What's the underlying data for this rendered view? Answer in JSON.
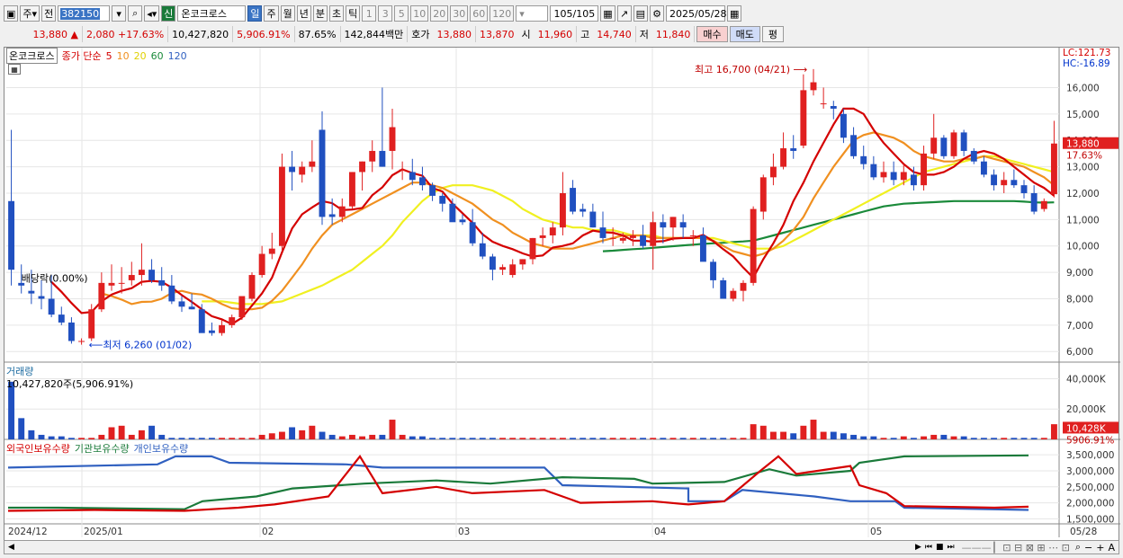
{
  "toolbar": {
    "type1": "주",
    "type2": "전",
    "code": "382150",
    "name": "온코크로스",
    "badge": "신",
    "periods": [
      "일",
      "주",
      "월",
      "년",
      "분",
      "초",
      "틱"
    ],
    "active_period": "일",
    "nums": [
      "1",
      "3",
      "5",
      "10",
      "20",
      "30",
      "60",
      "120"
    ],
    "count": "105/105",
    "date": "2025/05/28"
  },
  "quote": {
    "price": "13,880",
    "arrow": "▲",
    "change": "2,080",
    "rate": "+17.63%",
    "volume": "10,427,820",
    "vol_rate": "5,906.91%",
    "ratio": "87.65%",
    "amount": "142,844백만",
    "ask_label": "호가",
    "ask": "13,880",
    "bid": "13,870",
    "open_label": "시",
    "open": "11,960",
    "high_label": "고",
    "high": "14,740",
    "low_label": "저",
    "low": "11,840",
    "buy": "매수",
    "sell": "매도",
    "eval": "평"
  },
  "price_panel": {
    "name": "온코크로스",
    "series_label": "종가 단순",
    "ma": [
      {
        "p": "5",
        "c": "#d40000"
      },
      {
        "p": "10",
        "c": "#f09020"
      },
      {
        "p": "20",
        "c": "#e0e000"
      },
      {
        "p": "60",
        "c": "#1a8a3a"
      },
      {
        "p": "120",
        "c": "#3060c0"
      }
    ],
    "lc": "LC:121.73",
    "hc": "HC:-16.89",
    "high_note": "최고 16,700 (04/21)",
    "low_note": "최저 6,260 (01/02)",
    "div_note": "배당락(0.00%)",
    "yticks": [
      "16,000",
      "15,000",
      "14,000",
      "13,000",
      "12,000",
      "11,000",
      "10,000",
      "9,000",
      "8,000",
      "7,000",
      "6,000"
    ],
    "last_price": "13,880",
    "last_rate": "17.63%"
  },
  "volume_panel": {
    "title": "거래량",
    "readout": "10,427,820주(5,906.91%)",
    "yticks": [
      "40,000K",
      "20,000K"
    ],
    "last": "10,428K",
    "last_rate": "5906.91%"
  },
  "holder_panel": {
    "legend": [
      {
        "t": "외국인보유수량",
        "c": "#d40000"
      },
      {
        "t": "기관보유수량",
        "c": "#1a7a3a"
      },
      {
        "t": "개인보유수량",
        "c": "#3060c0"
      }
    ],
    "yticks": [
      "3,500,000",
      "3,000,000",
      "2,500,000",
      "2,000,000",
      "1,500,000"
    ]
  },
  "xaxis": [
    "2024/12",
    "2025/01",
    "02",
    "03",
    "04",
    "05",
    "05/28"
  ],
  "colors": {
    "up": "#e02020",
    "down": "#2050c0",
    "ma5": "#d40000",
    "ma10": "#f09020",
    "ma20": "#f0f020",
    "ma60": "#1a8a3a"
  },
  "chart_data": {
    "type": "candlestick",
    "note": "daily candles approx., KRW",
    "candles": [
      [
        11700,
        14400,
        8500,
        9100
      ],
      [
        8600,
        9300,
        8200,
        8500
      ],
      [
        8300,
        9100,
        7800,
        8200
      ],
      [
        8100,
        8700,
        7600,
        8000
      ],
      [
        8000,
        8900,
        7300,
        7400
      ],
      [
        7400,
        7700,
        7000,
        7100
      ],
      [
        7100,
        7300,
        6300,
        6400
      ],
      [
        6400,
        6500,
        6260,
        6400
      ],
      [
        6500,
        7800,
        6400,
        7600
      ],
      [
        7600,
        9000,
        7500,
        8600
      ],
      [
        8500,
        9300,
        8300,
        8600
      ],
      [
        8600,
        9200,
        8200,
        8600
      ],
      [
        8700,
        9400,
        8500,
        8900
      ],
      [
        8900,
        10100,
        8500,
        9100
      ],
      [
        9100,
        9500,
        8600,
        8700
      ],
      [
        8700,
        9200,
        8300,
        8500
      ],
      [
        8500,
        8900,
        7800,
        7900
      ],
      [
        7900,
        8100,
        7500,
        7700
      ],
      [
        7700,
        8200,
        7600,
        7600
      ],
      [
        7600,
        7800,
        6800,
        6700
      ],
      [
        6800,
        7100,
        6600,
        6700
      ],
      [
        6700,
        7200,
        6600,
        7000
      ],
      [
        7000,
        7400,
        6900,
        7300
      ],
      [
        7300,
        8000,
        7200,
        8100
      ],
      [
        8000,
        9000,
        7900,
        8900
      ],
      [
        8900,
        10000,
        8800,
        9700
      ],
      [
        9700,
        10500,
        9500,
        9900
      ],
      [
        10000,
        13500,
        9800,
        13000
      ],
      [
        13000,
        13600,
        12100,
        12800
      ],
      [
        12700,
        13200,
        12400,
        13000
      ],
      [
        13000,
        14000,
        12800,
        13200
      ],
      [
        14400,
        15100,
        10800,
        11100
      ],
      [
        11200,
        11800,
        10800,
        11100
      ],
      [
        11100,
        11800,
        10900,
        11500
      ],
      [
        11500,
        12800,
        11400,
        12800
      ],
      [
        12800,
        13200,
        12100,
        13200
      ],
      [
        13200,
        14000,
        12800,
        13600
      ],
      [
        13600,
        16000,
        13000,
        13000
      ],
      [
        13600,
        15200,
        12900,
        14500
      ],
      [
        12900,
        13200,
        12500,
        12900
      ],
      [
        12800,
        13300,
        12300,
        12500
      ],
      [
        12600,
        13000,
        12100,
        12300
      ],
      [
        12300,
        12400,
        11700,
        11900
      ],
      [
        11900,
        12000,
        11300,
        11600
      ],
      [
        11600,
        11800,
        11000,
        10900
      ],
      [
        11000,
        11200,
        10800,
        10900
      ],
      [
        10900,
        11400,
        10000,
        10100
      ],
      [
        10100,
        10500,
        9500,
        9600
      ],
      [
        9600,
        9700,
        8700,
        9100
      ],
      [
        9100,
        9300,
        8900,
        9200
      ],
      [
        8900,
        9500,
        8800,
        9300
      ],
      [
        9300,
        9500,
        9100,
        9500
      ],
      [
        9500,
        10300,
        9300,
        10300
      ],
      [
        10300,
        10700,
        10000,
        10400
      ],
      [
        10400,
        10900,
        10100,
        10700
      ],
      [
        10700,
        12800,
        10400,
        12000
      ],
      [
        12200,
        12500,
        11200,
        11300
      ],
      [
        11400,
        11600,
        11100,
        11300
      ],
      [
        11300,
        11600,
        10700,
        10700
      ],
      [
        10700,
        11300,
        10100,
        10300
      ],
      [
        10300,
        10700,
        10000,
        10300
      ],
      [
        10200,
        10500,
        10100,
        10300
      ],
      [
        10300,
        10600,
        10000,
        10400
      ],
      [
        10400,
        10800,
        9900,
        10000
      ],
      [
        10000,
        11300,
        9100,
        10900
      ],
      [
        10900,
        11200,
        10100,
        10700
      ],
      [
        10700,
        11100,
        10200,
        11100
      ],
      [
        10900,
        11200,
        10300,
        10700
      ],
      [
        10400,
        10600,
        10000,
        10400
      ],
      [
        10400,
        10700,
        9900,
        9400
      ],
      [
        9400,
        9500,
        8400,
        8700
      ],
      [
        8700,
        8800,
        8100,
        8000
      ],
      [
        8000,
        8400,
        7900,
        8300
      ],
      [
        8300,
        8700,
        7900,
        8600
      ],
      [
        8600,
        11500,
        8500,
        11400
      ],
      [
        11300,
        12700,
        11000,
        12600
      ],
      [
        12600,
        13500,
        12300,
        13000
      ],
      [
        13000,
        14300,
        12900,
        13700
      ],
      [
        13700,
        14200,
        13300,
        13600
      ],
      [
        13800,
        16500,
        13700,
        15900
      ],
      [
        15900,
        16700,
        15700,
        16200
      ],
      [
        15400,
        16000,
        15200,
        15400
      ],
      [
        15300,
        15500,
        14800,
        15200
      ],
      [
        15000,
        15200,
        13900,
        14100
      ],
      [
        14200,
        14500,
        13300,
        13400
      ],
      [
        13400,
        13800,
        12900,
        13100
      ],
      [
        13100,
        13400,
        12500,
        12600
      ],
      [
        12600,
        13200,
        12400,
        12800
      ],
      [
        12800,
        13200,
        12300,
        12500
      ],
      [
        12500,
        13100,
        12300,
        12800
      ],
      [
        12700,
        13000,
        12100,
        12300
      ],
      [
        12300,
        13800,
        12100,
        13500
      ],
      [
        13500,
        15000,
        13300,
        14100
      ],
      [
        14100,
        14200,
        13300,
        13400
      ],
      [
        13400,
        14400,
        13300,
        14300
      ],
      [
        14300,
        14400,
        13400,
        13600
      ],
      [
        13600,
        13700,
        13100,
        13200
      ],
      [
        13200,
        13400,
        12600,
        12700
      ],
      [
        12700,
        12900,
        12100,
        12300
      ],
      [
        12300,
        12800,
        12000,
        12500
      ],
      [
        12500,
        12900,
        12200,
        12300
      ],
      [
        12300,
        12500,
        11800,
        12000
      ],
      [
        12000,
        12300,
        11200,
        11300
      ],
      [
        11400,
        11800,
        11300,
        11700
      ],
      [
        11960,
        14740,
        11840,
        13880
      ]
    ],
    "volumes": [
      38,
      14,
      6,
      3,
      2,
      2,
      1,
      1,
      1,
      3,
      8,
      9,
      3,
      6,
      9,
      3,
      1,
      1,
      1,
      1,
      1,
      1,
      1,
      1,
      1,
      3,
      4,
      5,
      8,
      6,
      9,
      5,
      3,
      2,
      3,
      2,
      3,
      3,
      13,
      3,
      2,
      2,
      1,
      1,
      1,
      1,
      1,
      1,
      1,
      1,
      1,
      1,
      1,
      1,
      1,
      1,
      1,
      1,
      1,
      1,
      1,
      1,
      1,
      1,
      1,
      1,
      1,
      1,
      1,
      1,
      1,
      1,
      1,
      1,
      10,
      9,
      5,
      5,
      4,
      9,
      13,
      5,
      5,
      4,
      3,
      2,
      2,
      1,
      1,
      2,
      1,
      2,
      3,
      3,
      2,
      2,
      1,
      1,
      1,
      1,
      1,
      1,
      1,
      1,
      10
    ],
    "ma5": [
      null,
      null,
      null,
      null,
      8640,
      8260,
      7840,
      7460,
      7500,
      7900,
      8160,
      8300,
      8400,
      8640,
      8680,
      8640,
      8420,
      8140,
      7880,
      7600,
      7340,
      7220,
      7040,
      7280,
      7740,
      8200,
      8800,
      9760,
      10660,
      11200,
      11460,
      11700,
      11620,
      11360,
      11380,
      11440,
      11920,
      12220,
      12680,
      12900,
      12760,
      12660,
      12200,
      12060,
      11600,
      11240,
      10880,
      10440,
      10160,
      10000,
      9880,
      9720,
      9600,
      9640,
      9940,
      10000,
      10100,
      10400,
      10580,
      10520,
      10500,
      10400,
      10200,
      10200,
      10160,
      10180,
      10280,
      10300,
      10300,
      10420,
      10180,
      9880,
      9600,
      9180,
      8800,
      9500,
      10100,
      10800,
      11700,
      12400,
      13200,
      13900,
      14600,
      15200,
      15200,
      15000,
      14400,
      13900,
      13500,
      13100,
      12800,
      12700,
      12700,
      12800,
      13000,
      13300,
      13500,
      13600,
      13500,
      13300,
      13000,
      12700,
      12400,
      12200,
      11900
    ],
    "ma10": [
      null,
      null,
      null,
      null,
      null,
      null,
      null,
      null,
      null,
      8200,
      8100,
      7970,
      7800,
      7880,
      7890,
      8000,
      8220,
      8300,
      8200,
      8160,
      8000,
      7800,
      7640,
      7600,
      7600,
      7660,
      7920,
      8300,
      8800,
      9300,
      9900,
      10400,
      10800,
      11000,
      11200,
      11400,
      11600,
      11800,
      12000,
      12200,
      12400,
      12400,
      12300,
      12200,
      12000,
      11800,
      11600,
      11300,
      11000,
      10800,
      10500,
      10300,
      10100,
      10000,
      9900,
      9900,
      9900,
      10000,
      10100,
      10200,
      10300,
      10400,
      10400,
      10400,
      10300,
      10300,
      10300,
      10300,
      10300,
      10300,
      10200,
      10000,
      9800,
      9700,
      9600,
      9700,
      9900,
      10200,
      10600,
      11100,
      11800,
      12400,
      13000,
      13500,
      14000,
      14200,
      14300,
      14200,
      14100,
      13900,
      13600,
      13400,
      13300,
      13200,
      13200,
      13300,
      13300,
      13400,
      13300,
      13200,
      13100,
      13000,
      12800,
      12600,
      12300
    ],
    "ma20": [
      null,
      null,
      null,
      null,
      null,
      null,
      null,
      null,
      null,
      null,
      null,
      null,
      null,
      null,
      null,
      null,
      null,
      null,
      null,
      7900,
      7900,
      7900,
      7850,
      7800,
      7800,
      7800,
      7850,
      7900,
      8050,
      8200,
      8350,
      8500,
      8700,
      8900,
      9100,
      9400,
      9700,
      10000,
      10400,
      10900,
      11300,
      11700,
      12000,
      12200,
      12300,
      12300,
      12300,
      12200,
      12100,
      11900,
      11700,
      11400,
      11200,
      11000,
      10900,
      10800,
      10700,
      10700,
      10600,
      10600,
      10600,
      10500,
      10400,
      10400,
      10400,
      10300,
      10300,
      10300,
      10300,
      10300,
      10300,
      10200,
      10100,
      10000,
      9900,
      9900,
      9900,
      10000,
      10200,
      10400,
      10600,
      10800,
      11000,
      11200,
      11400,
      11600,
      11800,
      12000,
      12200,
      12400,
      12600,
      12800,
      12900,
      13000,
      13100,
      13200,
      13300,
      13400,
      13400,
      13300,
      13200,
      13100,
      13000,
      12900,
      12800
    ],
    "ma60": [
      null,
      null,
      null,
      null,
      null,
      null,
      null,
      null,
      null,
      null,
      null,
      null,
      null,
      null,
      null,
      null,
      null,
      null,
      null,
      null,
      null,
      null,
      null,
      null,
      null,
      null,
      null,
      null,
      null,
      null,
      null,
      null,
      null,
      null,
      null,
      null,
      null,
      null,
      null,
      null,
      null,
      null,
      null,
      null,
      null,
      null,
      null,
      null,
      null,
      null,
      null,
      null,
      null,
      null,
      null,
      null,
      null,
      null,
      null,
      9800,
      9820,
      9850,
      9880,
      9900,
      9930,
      9960,
      9990,
      10020,
      10050,
      10080,
      10100,
      10120,
      10150,
      10170,
      10200,
      10300,
      10400,
      10500,
      10600,
      10700,
      10800,
      10900,
      11000,
      11100,
      11200,
      11300,
      11400,
      11500,
      11550,
      11600,
      11620,
      11640,
      11660,
      11680,
      11700,
      11700,
      11700,
      11700,
      11700,
      11700,
      11700,
      11680,
      11650,
      11640,
      11650
    ]
  }
}
